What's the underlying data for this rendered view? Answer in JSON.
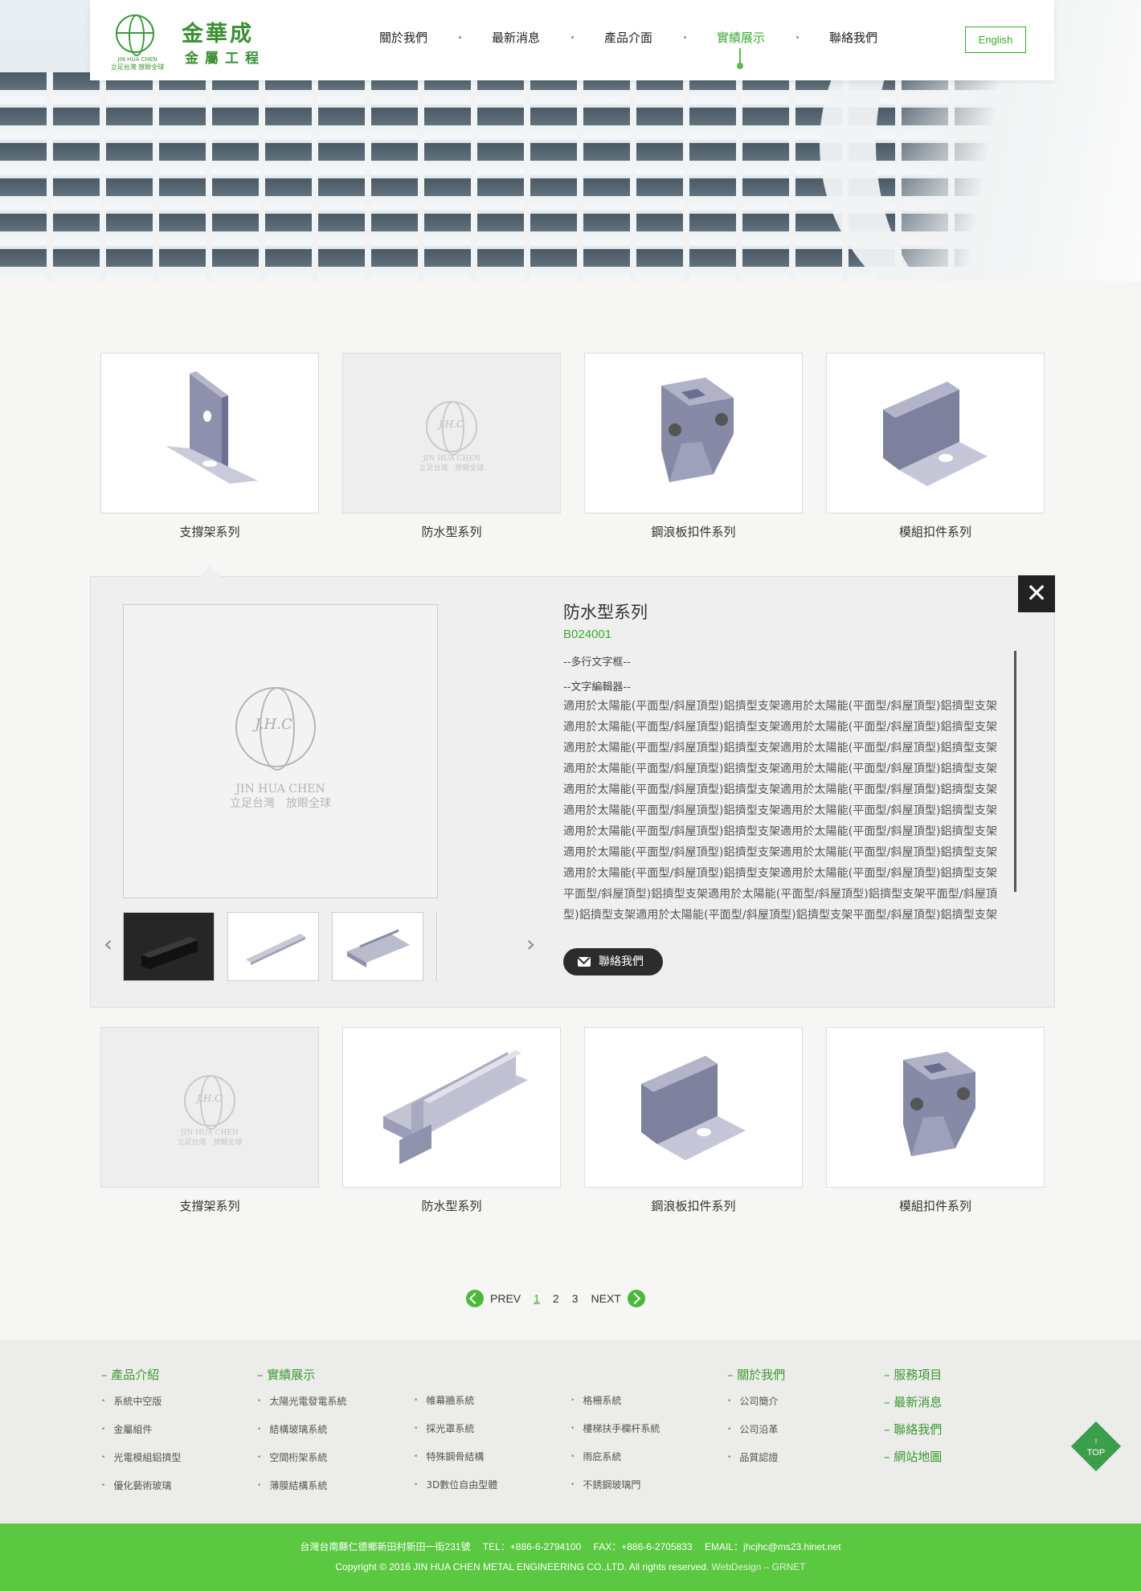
{
  "header": {
    "logo_cn": "金華成",
    "logo_cn2": "金屬工程",
    "logo_en": "JIN HUA CHEN",
    "logo_sub": "立足台灣 放眼全球",
    "menu": [
      "關於我們",
      "最新消息",
      "產品介面",
      "實績展示",
      "聯絡我們"
    ],
    "active_index": 3,
    "english_label": "English"
  },
  "placeholder": {
    "en": "JIN HUA CHEN",
    "sub": "立足台灣　放眼全球"
  },
  "cards_top": [
    "支撐架系列",
    "防水型系列",
    "鋼浪板扣件系列",
    "模組扣件系列"
  ],
  "cards_bottom": [
    "支撐架系列",
    "防水型系列",
    "鋼浪板扣件系列",
    "模組扣件系列"
  ],
  "detail": {
    "close": "✕",
    "title": "防水型系列",
    "code": "B024001",
    "line1": "--多行文字框--",
    "line2": "--文字編輯器--",
    "text": "適用於太陽能(平面型/斜屋頂型)鋁擠型支架適用於太陽能(平面型/斜屋頂型)鋁擠型支架適用於太陽能(平面型/斜屋頂型)鋁擠型支架適用於太陽能(平面型/斜屋頂型)鋁擠型支架適用於太陽能(平面型/斜屋頂型)鋁擠型支架適用於太陽能(平面型/斜屋頂型)鋁擠型支架適用於太陽能(平面型/斜屋頂型)鋁擠型支架適用於太陽能(平面型/斜屋頂型)鋁擠型支架適用於太陽能(平面型/斜屋頂型)鋁擠型支架適用於太陽能(平面型/斜屋頂型)鋁擠型支架適用於太陽能(平面型/斜屋頂型)鋁擠型支架適用於太陽能(平面型/斜屋頂型)鋁擠型支架適用於太陽能(平面型/斜屋頂型)鋁擠型支架適用於太陽能(平面型/斜屋頂型)鋁擠型支架適用於太陽能(平面型/斜屋頂型)鋁擠型支架適用於太陽能(平面型/斜屋頂型)鋁擠型支架適用於太陽能(平面型/斜屋頂型)鋁擠型支架適用於太陽能(平面型/斜屋頂型)鋁擠型支架平面型/斜屋頂型)鋁擠型支架適用於太陽能(平面型/斜屋頂型)鋁擠型支架平面型/斜屋頂型)鋁擠型支架適用於太陽能(平面型/斜屋頂型)鋁擠型支架平面型/斜屋頂型)鋁擠型支架適用於太陽能(平面型/斜屋頂型)鋁擠型支架平面型/斜屋頂型)鋁擠型支架",
    "contact_label": "聯絡我們",
    "prev_arrow": "‹",
    "next_arrow": "›"
  },
  "pager": {
    "prev": "PREV",
    "pages": [
      "1",
      "2",
      "3"
    ],
    "current": "1",
    "next": "NEXT"
  },
  "footer": {
    "col1": {
      "title": "產品介紹",
      "items": [
        "系統中空版",
        "金屬組件",
        "光電模組鋁擠型",
        "優化藝術玻璃"
      ]
    },
    "col2": {
      "title": "實績展示",
      "items": [
        "太陽光電發電系統",
        "結構玻璃系統",
        "空間桁架系統",
        "薄膜結構系統"
      ]
    },
    "col3": {
      "items": [
        "帷幕牆系統",
        "採光罩系統",
        "特殊鋼骨結構",
        "3D數位自由型體"
      ]
    },
    "col4": {
      "items": [
        "格柵系統",
        "樓梯扶手欄杆系統",
        "雨庇系統",
        "不銹鋼玻璃門"
      ]
    },
    "col5": {
      "title": "關於我們",
      "items": [
        "公司簡介",
        "公司沿革",
        "品質認證"
      ]
    },
    "col6": [
      "服務項目",
      "最新消息",
      "聯絡我們",
      "網站地圖"
    ],
    "top_label": "TOP",
    "top_arrow": "↑"
  },
  "bottom": {
    "address": "台灣台南縣仁德鄉新田村新田一街231號　 TEL：+886-6-2794100　 FAX：+886-6-2705833　 EMAIL：jhcjhc@ms23.hinet.net",
    "copyright": "Copyright © 2016 JIN HUA CHEN METAL ENGINEERING CO.,LTD. All rights reserved.",
    "webdesign": " WebDesign – GRNET"
  },
  "colors": {
    "accent": "#3aaa2e",
    "footer_bar": "#5ac840",
    "close_bg": "#222222"
  }
}
